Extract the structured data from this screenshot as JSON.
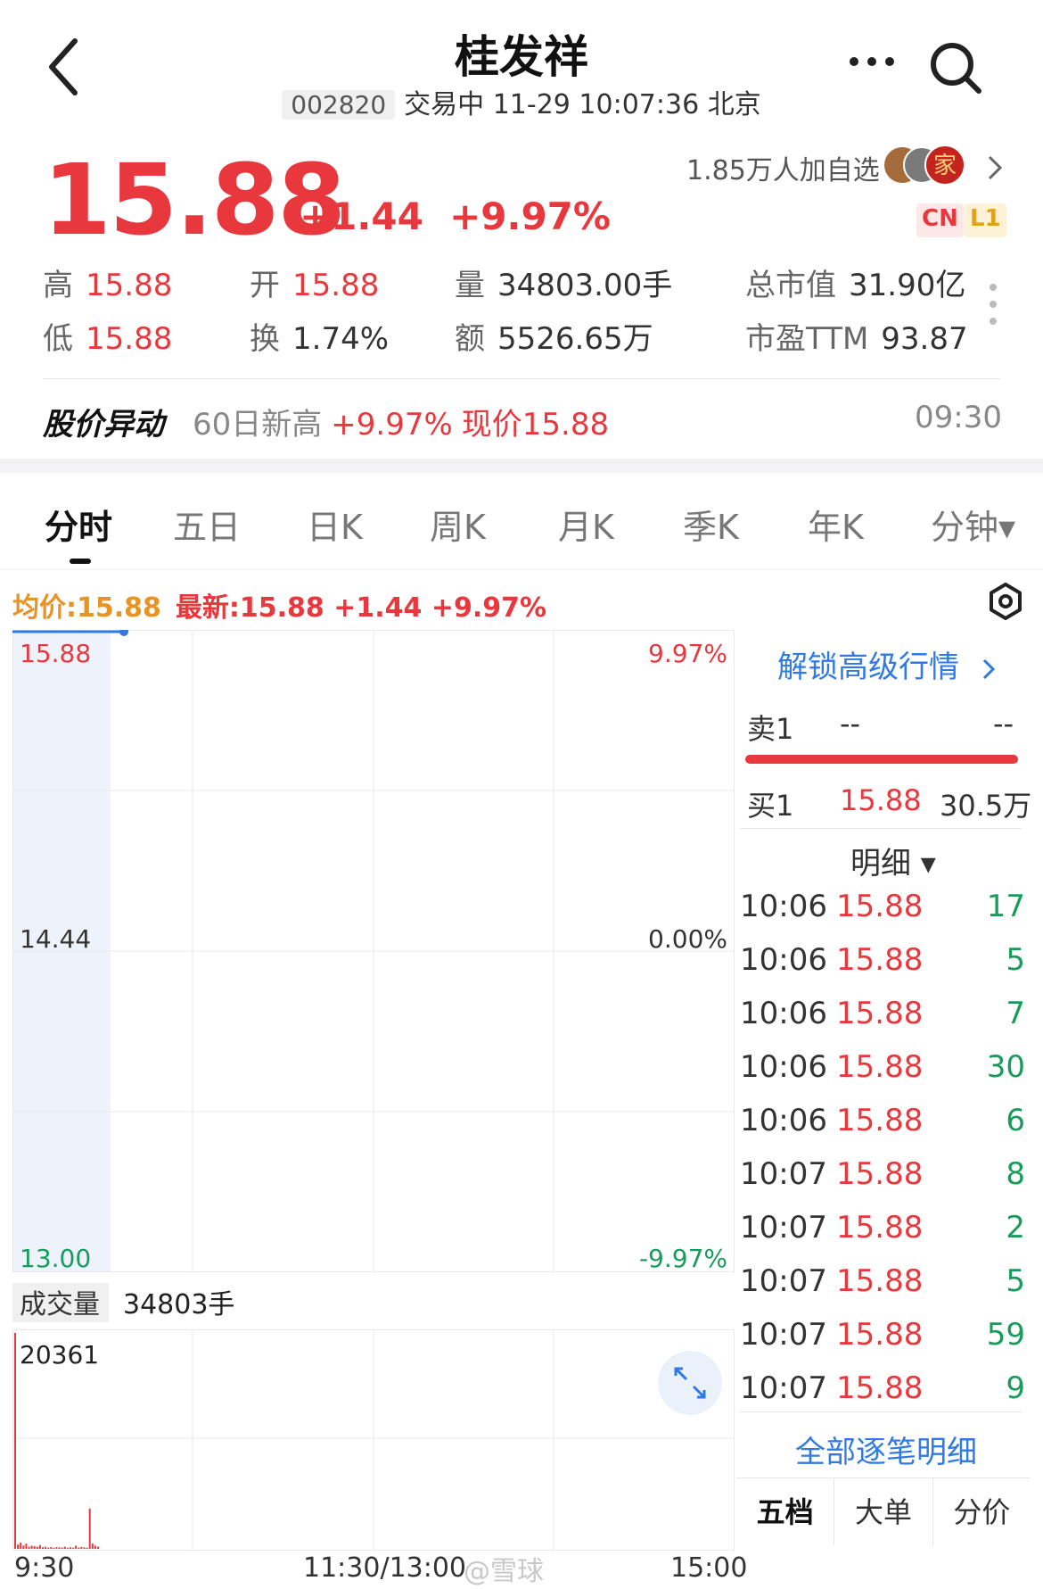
{
  "header": {
    "title": "桂发祥",
    "code": "002820",
    "status": "交易中 11-29 10:07:36 北京"
  },
  "quote": {
    "price": "15.88",
    "change": "+1.44",
    "change_pct": "+9.97%",
    "watchers": "1.85万人加自选",
    "avatar_char": "家",
    "badge_cn": "CN",
    "badge_l1": "L1"
  },
  "stats": {
    "high_label": "高",
    "high": "15.88",
    "low_label": "低",
    "low": "15.88",
    "open_label": "开",
    "open": "15.88",
    "turnover_label": "换",
    "turnover": "1.74%",
    "volume_label": "量",
    "volume": "34803.00手",
    "amount_label": "额",
    "amount": "5526.65万",
    "mktcap_label": "总市值",
    "mktcap": "31.90亿",
    "pe_label": "市盈TTM",
    "pe": "93.87"
  },
  "alert": {
    "label": "股价异动",
    "text": "60日新高",
    "pct": "+9.97%",
    "now": "现价15.88",
    "time": "09:30"
  },
  "tabs": [
    "分时",
    "五日",
    "日K",
    "周K",
    "月K",
    "季K",
    "年K",
    "分钟▾"
  ],
  "info": {
    "avg": "均价:15.88",
    "newest": "最新:15.88 +1.44 +9.97%"
  },
  "chart_data": {
    "type": "line",
    "price_axis": {
      "top": "15.88",
      "mid": "14.44",
      "bottom": "13.00"
    },
    "pct_axis": {
      "top": "9.97%",
      "mid": "0.00%",
      "bottom": "-9.97%"
    },
    "ylim": [
      13.0,
      15.88
    ],
    "x_labels": [
      "9:30",
      "11:30/13:00",
      "15:00"
    ],
    "series": [
      {
        "name": "最新",
        "values": [
          15.88,
          15.88
        ]
      },
      {
        "name": "均价",
        "values": [
          15.88,
          15.88
        ]
      }
    ],
    "volume": {
      "label": "成交量",
      "total": "34803手",
      "max_label": "20361",
      "max": 20361,
      "bars": [
        20361,
        400,
        600,
        300,
        500,
        200,
        300,
        250,
        200,
        350,
        150,
        200,
        120,
        180,
        100,
        160,
        140,
        120,
        200,
        100,
        150,
        100,
        300,
        120,
        180,
        140,
        100,
        3800,
        500,
        300,
        200
      ]
    }
  },
  "order_book": {
    "unlock": "解锁高级行情",
    "sell1_label": "卖1",
    "sell1_price": "--",
    "sell1_vol": "--",
    "buy1_label": "买1",
    "buy1_price": "15.88",
    "buy1_vol": "30.5万",
    "detail_header": "明细 ▾",
    "trades": [
      {
        "t": "10:06",
        "p": "15.88",
        "q": "17"
      },
      {
        "t": "10:06",
        "p": "15.88",
        "q": "5"
      },
      {
        "t": "10:06",
        "p": "15.88",
        "q": "7"
      },
      {
        "t": "10:06",
        "p": "15.88",
        "q": "30"
      },
      {
        "t": "10:06",
        "p": "15.88",
        "q": "6"
      },
      {
        "t": "10:07",
        "p": "15.88",
        "q": "8"
      },
      {
        "t": "10:07",
        "p": "15.88",
        "q": "2"
      },
      {
        "t": "10:07",
        "p": "15.88",
        "q": "5"
      },
      {
        "t": "10:07",
        "p": "15.88",
        "q": "59"
      },
      {
        "t": "10:07",
        "p": "15.88",
        "q": "9"
      }
    ],
    "all_details": "全部逐笔明细",
    "bottom_tabs": [
      "五档",
      "大单",
      "分价"
    ]
  },
  "watermark": "@雪球",
  "colors": {
    "up": "#e8383d",
    "down": "#1a9b5b",
    "avg": "#e99324",
    "link": "#2f7ae5"
  }
}
